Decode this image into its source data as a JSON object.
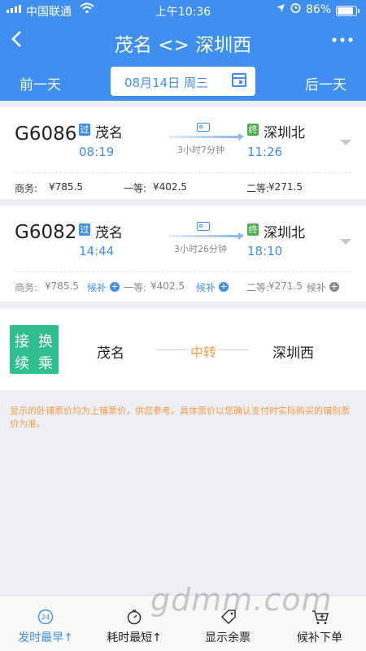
{
  "status_bar": {
    "carrier": "中国联通",
    "time": "上午10:36",
    "battery": "86%"
  },
  "nav": {
    "title": "茂名 <> 深圳西",
    "prev_day": "前一天",
    "next_day": "后一天",
    "date": "08月14日 周三"
  },
  "trains": [
    {
      "number": "G6086",
      "from_tag": "过",
      "from": "茂名",
      "depart": "08:19",
      "duration": "3小时7分钟",
      "to_tag": "终",
      "to": "深圳北",
      "arrive": "11:26",
      "seats": [
        {
          "label": "商务:",
          "price": "¥785.5"
        },
        {
          "label": "一等:",
          "price": "¥402.5"
        },
        {
          "label": "二等:",
          "price": "¥271.5"
        }
      ]
    },
    {
      "number": "G6082",
      "from_tag": "过",
      "from": "茂名",
      "depart": "14:44",
      "duration": "3小时26分钟",
      "to_tag": "终",
      "to": "深圳北",
      "arrive": "18:10",
      "seats": [
        {
          "label": "商务:",
          "price": "¥785.5",
          "waitlist": "候补"
        },
        {
          "label": "一等:",
          "price": "¥402.5",
          "waitlist": "候补"
        },
        {
          "label": "二等:",
          "price": "¥271.5",
          "waitlist": "候补"
        }
      ]
    }
  ],
  "transfer": {
    "badge": [
      "接",
      "换",
      "续",
      "乘"
    ],
    "from": "茂名",
    "via": "中转",
    "to": "深圳西"
  },
  "notice": "显示的卧铺票价均为上铺票价，供您参考。具体票价以您确认支付时实际购买的铺别票价为准。",
  "tabs": [
    {
      "label": "发时最早↑",
      "icon": "clock-24-icon"
    },
    {
      "label": "耗时最短↑",
      "icon": "stopwatch-icon"
    },
    {
      "label": "显示余票",
      "icon": "ticket-tag-icon"
    },
    {
      "label": "候补下单",
      "icon": "cart-plus-icon"
    }
  ],
  "icons": {
    "clock_badge": "24"
  },
  "watermark": "gdmm.com",
  "colors": {
    "primary": "#3e8ff0",
    "pass_tag": "#3e8ff0",
    "end_tag": "#4cb050",
    "transfer_badge": "#2fbf8f",
    "accent_orange": "#f29a46"
  }
}
